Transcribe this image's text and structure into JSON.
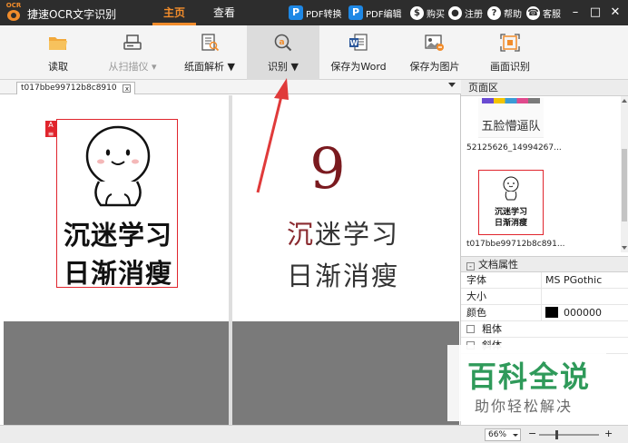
{
  "app": {
    "logo_text": "OCR",
    "title": "捷速OCR文字识别",
    "tabs": [
      {
        "label": "主页"
      },
      {
        "label": "查看"
      }
    ]
  },
  "title_actions": {
    "pdf_convert": "PDF转换",
    "pdf_edit": "PDF编辑",
    "buy": "购买",
    "register": "注册",
    "help": "帮助",
    "service": "客服"
  },
  "ribbon": {
    "read": "读取",
    "scanner": "从扫描仪 ▾",
    "page_parse": "纸面解析 ▼",
    "recognize": "识别 ▼",
    "save_word": "保存为Word",
    "save_image": "保存为图片",
    "screen_ocr": "画面识别"
  },
  "document": {
    "tab_name": "t017bbe99712b8c8910",
    "tab_close": "x",
    "ocr_badge": "A",
    "source_lines": [
      "沉迷学习",
      "日渐消瘦"
    ],
    "result_digit": "9",
    "result_line1_first": "沉",
    "result_line1_rest": "迷学习",
    "result_line2": "日渐消瘦"
  },
  "sidebar": {
    "pages_header": "页面区",
    "thumb1_text": "五脸懵逼队",
    "thumb1_name": "52125626_14994267...",
    "thumb2_lines": [
      "沉迷学习",
      "日渐消瘦"
    ],
    "thumb2_name": "t017bbe99712b8c891..."
  },
  "properties": {
    "header": "文档属性",
    "collapse": "-",
    "font_label": "字体",
    "font_value": "MS PGothic",
    "size_label": "大小",
    "color_label": "颜色",
    "color_value": "000000",
    "bold_label": "粗体",
    "italic_label": "斜体"
  },
  "watermark": {
    "line1": "百科全说",
    "line2": "助你轻松解决"
  },
  "status": {
    "zoom": "66%",
    "minus": "−",
    "plus": "+"
  },
  "colors": {
    "accent": "#f18c2b",
    "titlebar": "#2d2d2d",
    "selection_red": "#e0252d",
    "watermark_green": "#2f9a5a"
  }
}
